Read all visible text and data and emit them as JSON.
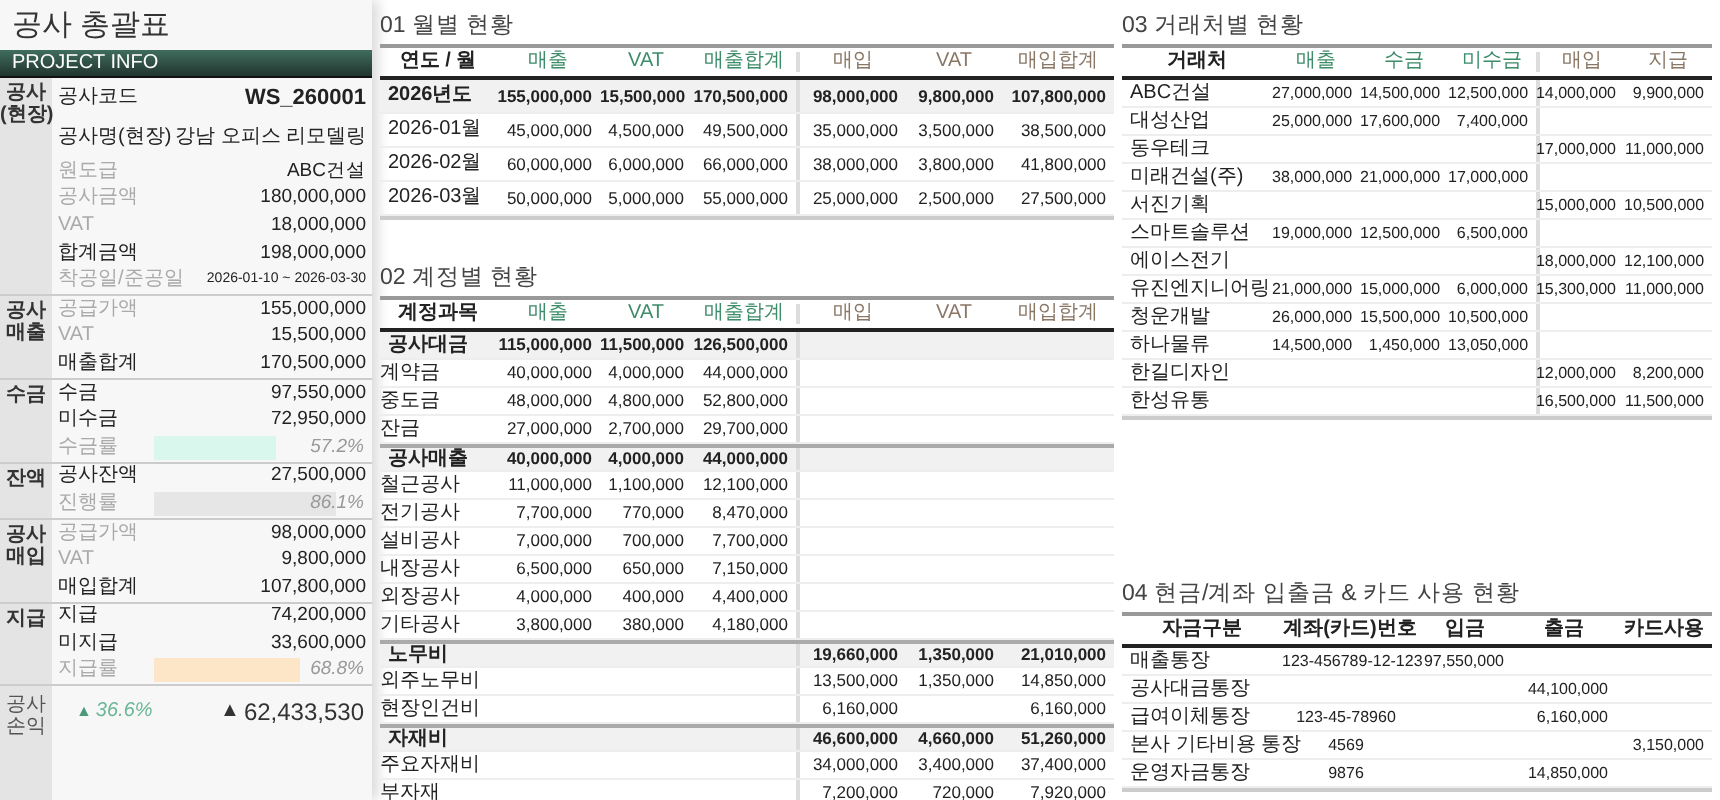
{
  "summary": {
    "title": "공사 총괄표",
    "header": "PROJECT INFO",
    "groups": [
      {
        "label": "공사\n(현장)",
        "rows": [
          {
            "kind": "text",
            "label": "공사코드",
            "value": "WS_260001",
            "bold": true
          },
          {
            "kind": "text",
            "label": "공사명(현장)",
            "value": "강남 오피스 리모델링",
            "bold": true
          },
          {
            "kind": "text",
            "label": "원도급",
            "value": "ABC건설",
            "bold": false
          },
          {
            "kind": "text",
            "label": "공사금액",
            "value": "180,000,000",
            "bold": false
          },
          {
            "kind": "text",
            "label": "VAT",
            "value": "18,000,000",
            "bold": false
          },
          {
            "kind": "text",
            "label": "합계금액",
            "value": "198,000,000",
            "bold": true
          },
          {
            "kind": "text",
            "label": "착공일/준공일",
            "value": "2026-01-10 ~ 2026-03-30",
            "bold": false
          }
        ]
      },
      {
        "label": "공사\n매출",
        "rows": [
          {
            "kind": "text",
            "label": "공급가액",
            "value": "155,000,000",
            "bold": false
          },
          {
            "kind": "text",
            "label": "VAT",
            "value": "15,500,000",
            "bold": false
          },
          {
            "kind": "text",
            "label": "매출합계",
            "value": "170,500,000",
            "bold": true
          }
        ]
      },
      {
        "label": "수금",
        "rows": [
          {
            "kind": "text",
            "label": "수금",
            "value": "97,550,000",
            "bold": true
          },
          {
            "kind": "text",
            "label": "미수금",
            "value": "72,950,000",
            "bold": true
          },
          {
            "kind": "bar",
            "label": "수금률",
            "value": "57.2%",
            "level": 0.572,
            "color": "#d9f7ec"
          }
        ]
      },
      {
        "label": "잔액",
        "rows": [
          {
            "kind": "text",
            "label": "공사잔액",
            "value": "27,500,000",
            "bold": true
          },
          {
            "kind": "bar",
            "label": "진행률",
            "value": "86.1%",
            "level": 0.861,
            "color": "#e6e6e6"
          }
        ]
      },
      {
        "label": "공사\n매입",
        "rows": [
          {
            "kind": "text",
            "label": "공급가액",
            "value": "98,000,000",
            "bold": false
          },
          {
            "kind": "text",
            "label": "VAT",
            "value": "9,800,000",
            "bold": false
          },
          {
            "kind": "text",
            "label": "매입합계",
            "value": "107,800,000",
            "bold": true
          }
        ]
      },
      {
        "label": "지급",
        "rows": [
          {
            "kind": "text",
            "label": "지급",
            "value": "74,200,000",
            "bold": true
          },
          {
            "kind": "text",
            "label": "미지급",
            "value": "33,600,000",
            "bold": true
          },
          {
            "kind": "bar",
            "label": "지급률",
            "value": "68.8%",
            "level": 0.688,
            "color": "#fde5c8"
          }
        ]
      }
    ],
    "profit": {
      "label": "공사\n손익",
      "rate_arrow": "▲",
      "rate": "36.6%",
      "amount_arrow": "▲",
      "amount": "62,433,530"
    }
  },
  "monthly": {
    "title": "01 월별 현황",
    "columns": [
      {
        "label": "연도 / 월",
        "kind": "label"
      },
      {
        "label": "매출",
        "kind": "sales"
      },
      {
        "label": "VAT",
        "kind": "sales"
      },
      {
        "label": "매출합계",
        "kind": "sales"
      },
      {
        "label": "매입",
        "kind": "purchase"
      },
      {
        "label": "VAT",
        "kind": "purchase"
      },
      {
        "label": "매입합계",
        "kind": "purchase"
      }
    ],
    "rows": [
      {
        "kind": "total",
        "cells": [
          "2026년도",
          "155,000,000",
          "15,500,000",
          "170,500,000",
          "98,000,000",
          "9,800,000",
          "107,800,000"
        ]
      },
      {
        "kind": "item",
        "cells": [
          "2026-01월",
          "45,000,000",
          "4,500,000",
          "49,500,000",
          "35,000,000",
          "3,500,000",
          "38,500,000"
        ]
      },
      {
        "kind": "item",
        "cells": [
          "2026-02월",
          "60,000,000",
          "6,000,000",
          "66,000,000",
          "38,000,000",
          "3,800,000",
          "41,800,000"
        ]
      },
      {
        "kind": "item",
        "cells": [
          "2026-03월",
          "50,000,000",
          "5,000,000",
          "55,000,000",
          "25,000,000",
          "2,500,000",
          "27,500,000"
        ]
      }
    ]
  },
  "accounts": {
    "title": "02 계정별 현황",
    "columns": [
      {
        "label": "계정과목",
        "kind": "label"
      },
      {
        "label": "매출",
        "kind": "sales"
      },
      {
        "label": "VAT",
        "kind": "sales"
      },
      {
        "label": "매출합계",
        "kind": "sales"
      },
      {
        "label": "매입",
        "kind": "purchase"
      },
      {
        "label": "VAT",
        "kind": "purchase"
      },
      {
        "label": "매입합계",
        "kind": "purchase"
      }
    ],
    "rows": [
      {
        "kind": "total",
        "cells": [
          "공사대금",
          "115,000,000",
          "11,500,000",
          "126,500,000",
          null,
          null,
          null
        ]
      },
      {
        "kind": "item",
        "cells": [
          "계약금",
          "40,000,000",
          "4,000,000",
          "44,000,000",
          null,
          null,
          null
        ]
      },
      {
        "kind": "item",
        "cells": [
          "중도금",
          "48,000,000",
          "4,800,000",
          "52,800,000",
          null,
          null,
          null
        ]
      },
      {
        "kind": "item",
        "cells": [
          "잔금",
          "27,000,000",
          "2,700,000",
          "29,700,000",
          null,
          null,
          null
        ]
      },
      {
        "kind": "total",
        "cells": [
          "공사매출",
          "40,000,000",
          "4,000,000",
          "44,000,000",
          null,
          null,
          null
        ]
      },
      {
        "kind": "item",
        "cells": [
          "철근공사",
          "11,000,000",
          "1,100,000",
          "12,100,000",
          null,
          null,
          null
        ]
      },
      {
        "kind": "item",
        "cells": [
          "전기공사",
          "7,700,000",
          "770,000",
          "8,470,000",
          null,
          null,
          null
        ]
      },
      {
        "kind": "item",
        "cells": [
          "설비공사",
          "7,000,000",
          "700,000",
          "7,700,000",
          null,
          null,
          null
        ]
      },
      {
        "kind": "item",
        "cells": [
          "내장공사",
          "6,500,000",
          "650,000",
          "7,150,000",
          null,
          null,
          null
        ]
      },
      {
        "kind": "item",
        "cells": [
          "외장공사",
          "4,000,000",
          "400,000",
          "4,400,000",
          null,
          null,
          null
        ]
      },
      {
        "kind": "item",
        "cells": [
          "기타공사",
          "3,800,000",
          "380,000",
          "4,180,000",
          null,
          null,
          null
        ]
      },
      {
        "kind": "total",
        "cells": [
          "노무비",
          null,
          null,
          null,
          "19,660,000",
          "1,350,000",
          "21,010,000"
        ]
      },
      {
        "kind": "item",
        "cells": [
          "외주노무비",
          null,
          null,
          null,
          "13,500,000",
          "1,350,000",
          "14,850,000"
        ]
      },
      {
        "kind": "item",
        "cells": [
          "현장인건비",
          null,
          null,
          null,
          "6,160,000",
          null,
          "6,160,000"
        ]
      },
      {
        "kind": "total",
        "cells": [
          "자재비",
          null,
          null,
          null,
          "46,600,000",
          "4,660,000",
          "51,260,000"
        ]
      },
      {
        "kind": "item",
        "cells": [
          "주요자재비",
          null,
          null,
          null,
          "34,000,000",
          "3,400,000",
          "37,400,000"
        ]
      },
      {
        "kind": "item",
        "cells": [
          "부자재",
          null,
          null,
          null,
          "7,200,000",
          "720,000",
          "7,920,000"
        ]
      }
    ]
  },
  "partners": {
    "title": "03 거래처별 현황",
    "columns": [
      {
        "label": "거래처",
        "kind": "label"
      },
      {
        "label": "매출",
        "kind": "sales"
      },
      {
        "label": "수금",
        "kind": "sales"
      },
      {
        "label": "미수금",
        "kind": "sales"
      },
      {
        "label": "매입",
        "kind": "purchase"
      },
      {
        "label": "지급",
        "kind": "purchase"
      }
    ],
    "rows": [
      {
        "cells": [
          "ABC건설",
          "27,000,000",
          "14,500,000",
          "12,500,000",
          "14,000,000",
          "9,900,000"
        ]
      },
      {
        "cells": [
          "대성산업",
          "25,000,000",
          "17,600,000",
          "7,400,000",
          null,
          null
        ]
      },
      {
        "cells": [
          "동우테크",
          null,
          null,
          null,
          "17,000,000",
          "11,000,000"
        ]
      },
      {
        "cells": [
          "미래건설(주)",
          "38,000,000",
          "21,000,000",
          "17,000,000",
          null,
          null
        ]
      },
      {
        "cells": [
          "서진기획",
          null,
          null,
          null,
          "15,000,000",
          "10,500,000"
        ]
      },
      {
        "cells": [
          "스마트솔루션",
          "19,000,000",
          "12,500,000",
          "6,500,000",
          null,
          null
        ]
      },
      {
        "cells": [
          "에이스전기",
          null,
          null,
          null,
          "18,000,000",
          "12,100,000"
        ]
      },
      {
        "cells": [
          "유진엔지니어링",
          "21,000,000",
          "15,000,000",
          "6,000,000",
          "15,300,000",
          "11,000,000"
        ]
      },
      {
        "cells": [
          "청운개발",
          "26,000,000",
          "15,500,000",
          "10,500,000",
          null,
          null
        ]
      },
      {
        "cells": [
          "하나물류",
          "14,500,000",
          "1,450,000",
          "13,050,000",
          null,
          null
        ]
      },
      {
        "cells": [
          "한길디자인",
          null,
          null,
          null,
          "12,000,000",
          "8,200,000"
        ]
      },
      {
        "cells": [
          "한성유통",
          null,
          null,
          null,
          "16,500,000",
          "11,500,000"
        ]
      }
    ]
  },
  "cash": {
    "title": "04 현금/계좌 입출금 & 카드 사용 현황",
    "columns": [
      {
        "label": "자금구분",
        "kind": "label"
      },
      {
        "label": "계좌(카드)번호",
        "kind": "label"
      },
      {
        "label": "입금",
        "kind": "label"
      },
      {
        "label": "출금",
        "kind": "label"
      },
      {
        "label": "카드사용",
        "kind": "label"
      }
    ],
    "rows": [
      {
        "cells": [
          "매출통장",
          "123-456789-12-123",
          "97,550,000",
          null,
          null
        ]
      },
      {
        "cells": [
          "공사대금통장",
          null,
          null,
          "44,100,000",
          null
        ]
      },
      {
        "cells": [
          "급여이체통장",
          "123-45-78960",
          null,
          "6,160,000",
          null
        ]
      },
      {
        "cells": [
          "본사 기타비용 통장",
          "4569",
          null,
          null,
          "3,150,000"
        ]
      },
      {
        "cells": [
          "운영자금통장",
          "9876",
          null,
          "14,850,000",
          null
        ]
      }
    ]
  }
}
